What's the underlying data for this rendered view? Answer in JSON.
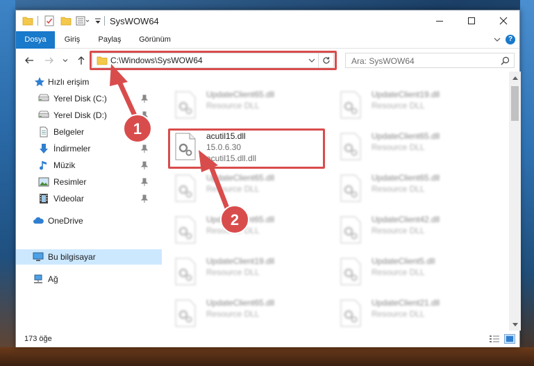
{
  "window": {
    "title": "SysWOW64"
  },
  "ribbon": {
    "tabs": [
      "Dosya",
      "Giriş",
      "Paylaş",
      "Görünüm"
    ],
    "help": "?"
  },
  "address": {
    "path": "C:\\Windows\\SysWOW64"
  },
  "search": {
    "placeholder": "Ara: SysWOW64"
  },
  "sidebar": {
    "items": [
      {
        "label": "Hızlı erişim",
        "icon": "star-icon"
      },
      {
        "label": "Yerel Disk (C:)",
        "icon": "drive-icon"
      },
      {
        "label": "Yerel Disk (D:)",
        "icon": "drive-icon"
      },
      {
        "label": "Belgeler",
        "icon": "documents-icon"
      },
      {
        "label": "İndirmeler",
        "icon": "download-arrow-icon"
      },
      {
        "label": "Müzik",
        "icon": "music-note-icon"
      },
      {
        "label": "Resimler",
        "icon": "pictures-icon"
      },
      {
        "label": "Videolar",
        "icon": "film-icon"
      },
      {
        "label": "OneDrive",
        "icon": "cloud-icon"
      },
      {
        "label": "Bu bilgisayar",
        "icon": "computer-icon"
      },
      {
        "label": "Ağ",
        "icon": "network-icon"
      }
    ]
  },
  "files": {
    "highlighted": {
      "name": "acutil15.dll",
      "version": "15.0.6.30",
      "description": "acutil15.dll.dll"
    },
    "left_column": [
      {
        "name": "UpdateClient65.dll",
        "type": "Resource DLL"
      },
      {
        "name": "UpdateClient65.dll",
        "type": "Resource DLL"
      },
      {
        "name": "UpdateClient65.dll",
        "type": "Resource DLL"
      },
      {
        "name": "UpdateClient19.dll",
        "type": "Resource DLL"
      },
      {
        "name": "UpdateClient65.dll",
        "type": "Resource DLL"
      }
    ],
    "right_column": [
      {
        "name": "UpdateClient19.dll",
        "type": "Resource DLL"
      },
      {
        "name": "UpdateClient65.dll",
        "type": "Resource DLL"
      },
      {
        "name": "UpdateClient65.dll",
        "type": "Resource DLL"
      },
      {
        "name": "UpdateClient42.dll",
        "type": "Resource DLL"
      },
      {
        "name": "UpdateClient5.dll",
        "type": "Resource DLL"
      },
      {
        "name": "UpdateClient21.dll",
        "type": "Resource DLL"
      }
    ]
  },
  "status": {
    "count": "173 öğe"
  },
  "annotations": {
    "badge1": "1",
    "badge2": "2",
    "color": "#d94c4c"
  }
}
